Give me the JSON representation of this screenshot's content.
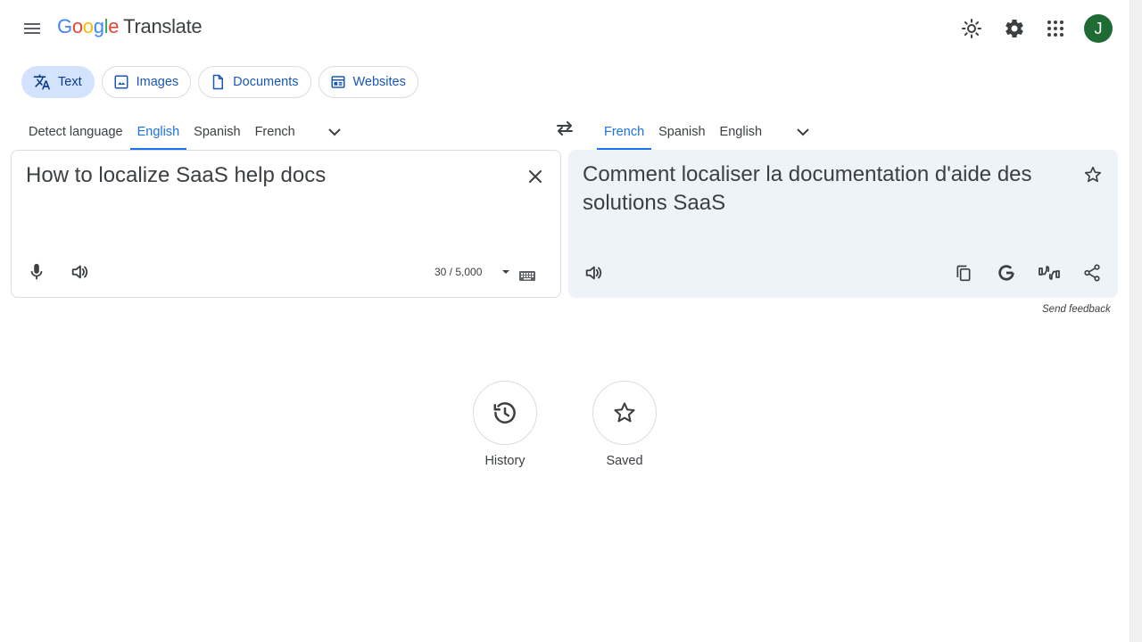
{
  "app": {
    "logo_letters": [
      "G",
      "o",
      "o",
      "g",
      "l",
      "e"
    ],
    "logo_colors": [
      "#4285f4",
      "#ea4335",
      "#fbbc05",
      "#4285f4",
      "#34a853",
      "#ea4335"
    ],
    "product": "Translate"
  },
  "header": {
    "avatar_initial": "J",
    "avatar_color": "#1e6b33",
    "icons": [
      "menu-icon",
      "theme-sun-icon",
      "settings-gear-icon",
      "apps-grid-icon"
    ]
  },
  "mode_tabs": [
    {
      "label": "Text",
      "icon": "translate-icon",
      "active": true
    },
    {
      "label": "Images",
      "icon": "image-icon",
      "active": false
    },
    {
      "label": "Documents",
      "icon": "document-icon",
      "active": false
    },
    {
      "label": "Websites",
      "icon": "website-icon",
      "active": false
    }
  ],
  "source_langs": {
    "tabs": [
      "Detect language",
      "English",
      "Spanish",
      "French"
    ],
    "active": "English"
  },
  "target_langs": {
    "tabs": [
      "French",
      "Spanish",
      "English"
    ],
    "active": "French"
  },
  "source": {
    "text": "How to localize SaaS help docs",
    "char_count": "30 / 5,000"
  },
  "target": {
    "text": "Comment localiser la documentation d'aide des solutions SaaS"
  },
  "feedback_label": "Send feedback",
  "shortcuts": {
    "history_label": "History",
    "saved_label": "Saved"
  },
  "colors": {
    "accent": "#1a73e8",
    "active_tab_bg": "#d3e3fd",
    "target_panel_bg": "#eef2f9"
  }
}
